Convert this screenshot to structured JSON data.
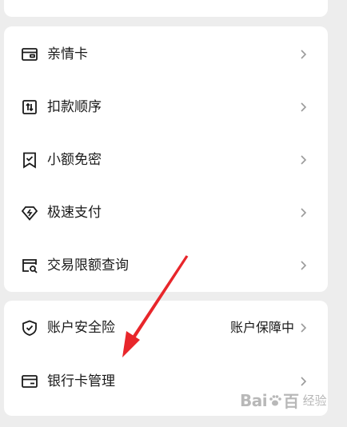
{
  "menu_group_1": [
    {
      "label": "亲情卡",
      "icon": "wallet-card-icon"
    },
    {
      "label": "扣款顺序",
      "icon": "deduction-order-icon"
    },
    {
      "label": "小额免密",
      "icon": "bookmark-check-icon"
    },
    {
      "label": "极速支付",
      "icon": "diamond-lightning-icon"
    },
    {
      "label": "交易限额查询",
      "icon": "card-search-icon"
    }
  ],
  "menu_group_2": [
    {
      "label": "账户安全险",
      "value": "账户保障中",
      "icon": "shield-check-icon"
    },
    {
      "label": "银行卡管理",
      "icon": "bank-card-icon"
    }
  ],
  "chevron_icon": "chevron-right-icon",
  "watermark": {
    "logo": "Bai",
    "logo_suffix": "百",
    "sub": "经验"
  },
  "colors": {
    "background": "#ededed",
    "card": "#ffffff",
    "annotation_arrow": "#e8262b"
  }
}
